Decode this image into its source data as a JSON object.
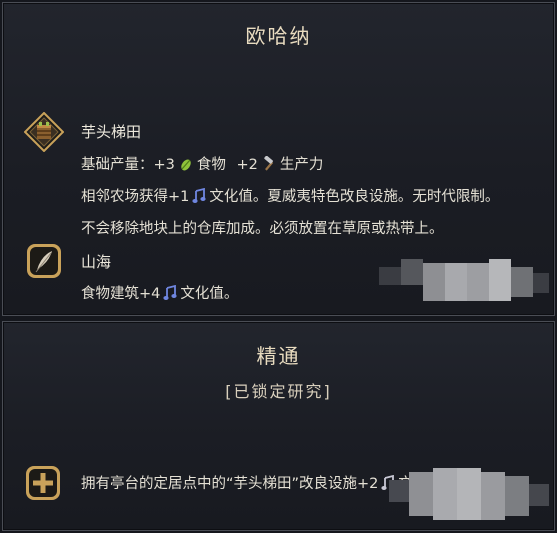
{
  "panels": {
    "civ": {
      "title": "欧哈纳",
      "improvement": {
        "name": "芋头梯田",
        "yield_prefix": "基础产量：",
        "food_amount": "+3",
        "food_label": "食物",
        "production_amount": "+2",
        "production_label": "生产力",
        "line2_pre": "相邻农场获得+1",
        "line2_post": "文化值。夏威夷特色改良设施。无时代限制。",
        "line3": "不会移除地块上的仓库加成。必须放置在草原或热带上。"
      },
      "tradition": {
        "name": "山海",
        "effect_pre": "食物建筑+4",
        "effect_post": "文化值。"
      }
    },
    "mastery": {
      "title": "精通",
      "status": "[已锁定研究]",
      "effect_text": "拥有亭台的定居点中的“芋头梯田”改良设施+2",
      "effect_trailing": "文化值"
    }
  },
  "icons": {
    "improvement_badge": "taro-terrace-badge-icon",
    "tradition_badge": "feather-quill-badge-icon",
    "mastery_badge": "plus-badge-icon",
    "food": "food-leaf-icon",
    "production": "hammer-icon",
    "culture": "music-note-icon"
  },
  "colors": {
    "gold": "#c9a25a",
    "food": "#8fc23a",
    "culture": "#6f86e0"
  }
}
